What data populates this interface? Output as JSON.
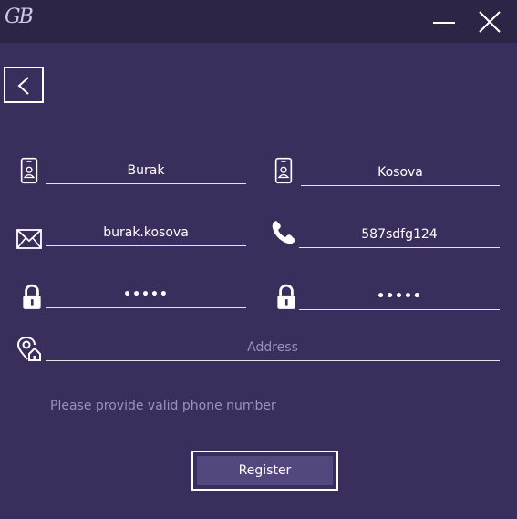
{
  "titlebar": {
    "logo": "GB"
  },
  "form": {
    "first_name": {
      "value": "Burak",
      "icon": "id-badge-icon"
    },
    "last_name": {
      "value": "Kosova",
      "icon": "id-badge-icon"
    },
    "username": {
      "value": "burak.kosova",
      "icon": "envelope-icon"
    },
    "phone": {
      "value": "587sdfg124",
      "icon": "phone-icon"
    },
    "password": {
      "value": "•••••",
      "icon": "lock-icon"
    },
    "confirm_password": {
      "value": "•••••",
      "icon": "lock-icon"
    },
    "address": {
      "value": "",
      "placeholder": "Address",
      "icon": "location-home-icon"
    }
  },
  "error_message": "Please provide valid phone number",
  "register_label": "Register",
  "colors": {
    "background": "#3a2f5c",
    "titlebar": "#2d2546",
    "button_fill": "#54477e",
    "muted_text": "#9a92b8"
  }
}
